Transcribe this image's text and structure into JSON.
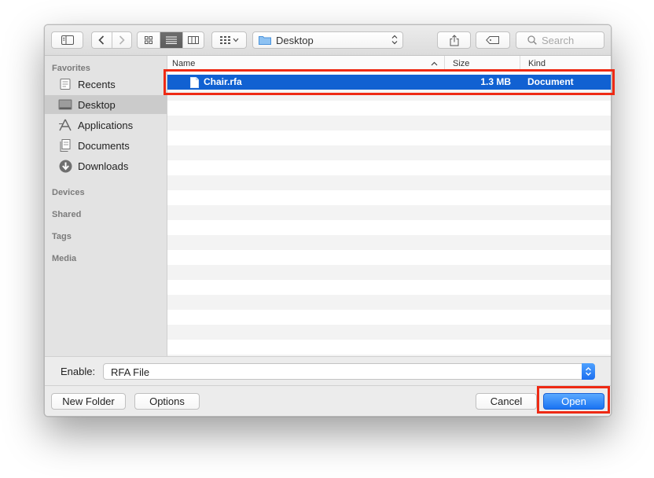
{
  "toolbar": {
    "location": "Desktop",
    "search_placeholder": "Search"
  },
  "sidebar": {
    "favorites_label": "Favorites",
    "items": [
      {
        "label": "Recents",
        "icon": "recents-icon"
      },
      {
        "label": "Desktop",
        "icon": "desktop-icon"
      },
      {
        "label": "Applications",
        "icon": "applications-icon"
      },
      {
        "label": "Documents",
        "icon": "documents-icon"
      },
      {
        "label": "Downloads",
        "icon": "downloads-icon"
      }
    ],
    "selected": "Desktop",
    "sections": [
      "Devices",
      "Shared",
      "Tags",
      "Media"
    ]
  },
  "file_list": {
    "columns": [
      "Name",
      "Size",
      "Kind"
    ],
    "sort_column": "Name",
    "files": [
      {
        "name": "Chair.rfa",
        "size": "1.3 MB",
        "kind": "Document",
        "selected": true
      }
    ]
  },
  "enable": {
    "label": "Enable:",
    "value": "RFA File"
  },
  "buttons": {
    "new_folder": "New Folder",
    "options": "Options",
    "cancel": "Cancel",
    "open": "Open"
  },
  "colors": {
    "selection": "#1161d2",
    "primary_button": "#1a73f2",
    "highlight_box": "#ee2a14"
  }
}
